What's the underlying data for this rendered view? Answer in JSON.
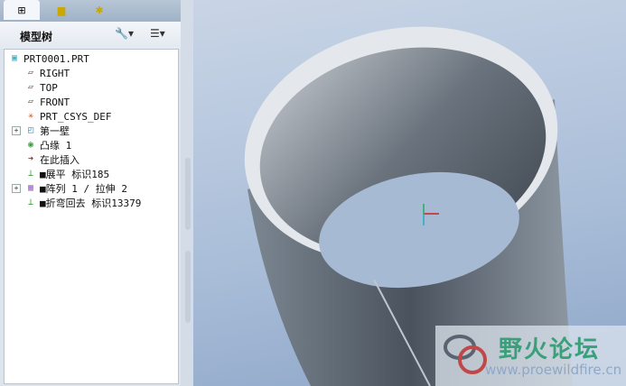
{
  "left_panel": {
    "tabs": [
      {
        "name": "model-tree-tab",
        "icon": "tree-icon"
      },
      {
        "name": "folder-browser-tab",
        "icon": "folders-icon"
      },
      {
        "name": "favorites-tab",
        "icon": "favorites-folder-icon"
      }
    ],
    "title": "模型树",
    "settings_icon": "tools-icon",
    "show_icon": "list-icon",
    "tree": [
      {
        "label": "PRT0001.PRT",
        "icon": "part-icon",
        "level": 0
      },
      {
        "label": "RIGHT",
        "icon": "datum-plane-icon",
        "level": 1
      },
      {
        "label": "TOP",
        "icon": "datum-plane-icon",
        "level": 1
      },
      {
        "label": "FRONT",
        "icon": "datum-plane-icon",
        "level": 1
      },
      {
        "label": "PRT_CSYS_DEF",
        "icon": "csys-icon",
        "level": 1
      },
      {
        "label": "第一壁",
        "icon": "first-wall-icon",
        "level": 1,
        "expandable": true
      },
      {
        "label": "凸缘 1",
        "icon": "flange-icon",
        "level": 1
      },
      {
        "label": "在此插入",
        "icon": "insert-here-arrow-icon",
        "level": 1
      },
      {
        "label": "■展平 标识185",
        "icon": "unbend-icon",
        "level": 1
      },
      {
        "label": "■阵列 1 / 拉伸 2",
        "icon": "pattern-icon",
        "level": 1,
        "expandable": true
      },
      {
        "label": "■折弯回去 标识13379",
        "icon": "bend-back-icon",
        "level": 1
      }
    ]
  },
  "watermark": {
    "name": "野火论坛",
    "url": "www.proewildfire.cn"
  },
  "colors": {
    "viewport_top": "#c9d5e6",
    "viewport_bottom": "#8da6c8",
    "model": "#6f7a86"
  }
}
